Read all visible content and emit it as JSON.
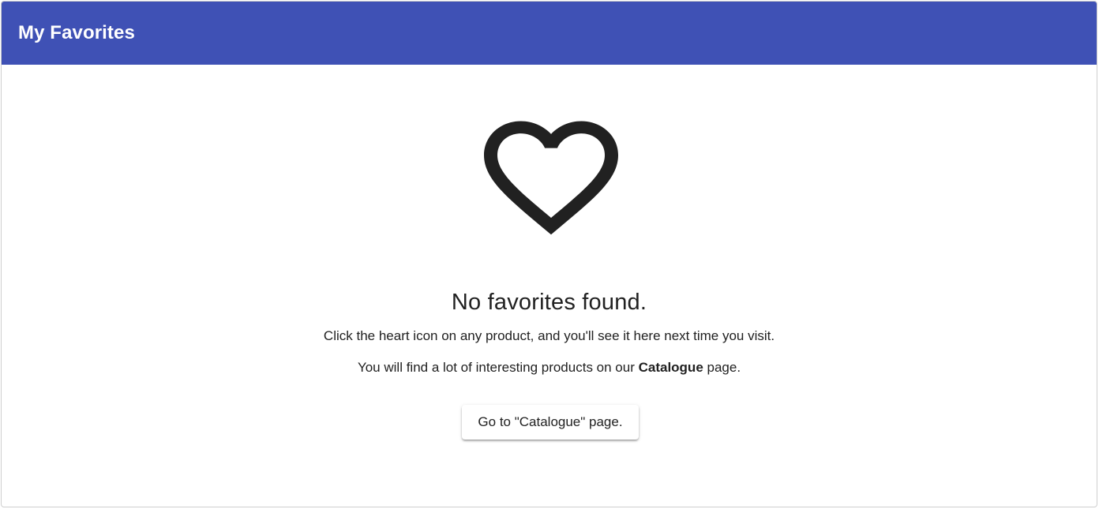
{
  "header": {
    "title": "My Favorites",
    "background": "#3f51b5"
  },
  "empty_state": {
    "icon": "heart-outline-icon",
    "title": "No favorites found.",
    "description": "Click the heart icon on any product, and you'll see it here next time you visit.",
    "hint_before": "You will find a lot of interesting products on our ",
    "hint_bold": "Catalogue",
    "hint_after": " page.",
    "button_label": "Go to \"Catalogue\" page."
  }
}
